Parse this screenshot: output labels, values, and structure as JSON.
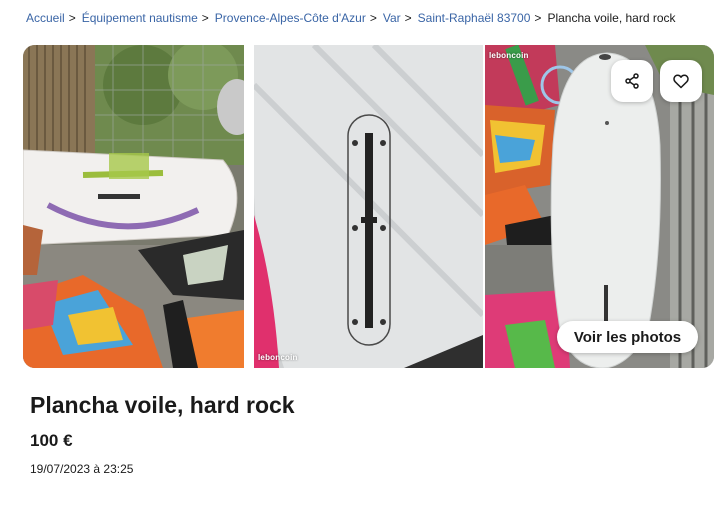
{
  "breadcrumb": {
    "items": [
      {
        "label": "Accueil"
      },
      {
        "label": "Équipement nautisme"
      },
      {
        "label": "Provence-Alpes-Côte d'Azur"
      },
      {
        "label": "Var"
      },
      {
        "label": "Saint-Raphaël 83700"
      }
    ],
    "separator": ">",
    "current": "Plancha voile, hard rock"
  },
  "gallery": {
    "watermark_1": "leboncoin",
    "watermark_2": "leboncoin",
    "show_photos_label": "Voir les photos",
    "share_icon": "share-icon",
    "favorite_icon": "heart-icon"
  },
  "ad": {
    "title": "Plancha voile, hard rock",
    "price": "100 €",
    "date": "19/07/2023 à 23:25"
  },
  "colors": {
    "link": "#3a65a6",
    "text": "#1a1a1a",
    "background": "#ffffff"
  }
}
